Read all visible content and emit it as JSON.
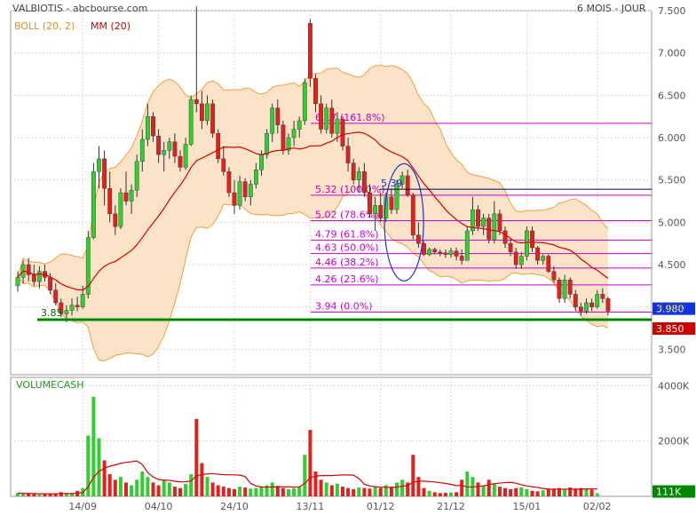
{
  "chart_data": {
    "type": "candlestick",
    "title": "VALBIOTIS - abcbourse.com",
    "period_label": "6 MOIS - JOUR",
    "indicators": {
      "boll_label": "BOLL (20, 2)",
      "ma_label": "MM (20)"
    },
    "x_labels": [
      "14/09",
      "04/10",
      "24/10",
      "13/11",
      "01/12",
      "21/12",
      "15/01",
      "02/02"
    ],
    "x_label_index": [
      12,
      26,
      40,
      54,
      67,
      80,
      94,
      107
    ],
    "price_axis": {
      "ylim": [
        3.2,
        7.5
      ],
      "ticks": [
        "3.500",
        "4.000",
        "4.500",
        "5.000",
        "5.500",
        "6.000",
        "6.500",
        "7.000",
        "7.500"
      ]
    },
    "last_price": "3.980",
    "support": {
      "value": 3.85,
      "left_label": "3.85",
      "right_label": "3.850"
    },
    "fibonacci": [
      {
        "value": 6.17,
        "label": "6.17  (161.8%)"
      },
      {
        "value": 5.32,
        "label": "5.32  (100.0%)"
      },
      {
        "value": 5.02,
        "label": "5.02  (78.6%)"
      },
      {
        "value": 4.79,
        "label": "4.79  (61.8%)"
      },
      {
        "value": 4.63,
        "label": "4.63  (50.0%)"
      },
      {
        "value": 4.46,
        "label": "4.46  (38.2%)"
      },
      {
        "value": 4.26,
        "label": "4.26  (23.6%)"
      },
      {
        "value": 3.94,
        "label": "3.94  (0.0%)"
      }
    ],
    "annotation": {
      "label": "5.39",
      "value": 5.39
    },
    "ohlc": [
      {
        "o": 4.25,
        "h": 4.42,
        "l": 4.18,
        "c": 4.35
      },
      {
        "o": 4.35,
        "h": 4.55,
        "l": 4.28,
        "c": 4.5
      },
      {
        "o": 4.5,
        "h": 4.58,
        "l": 4.3,
        "c": 4.38
      },
      {
        "o": 4.38,
        "h": 4.5,
        "l": 4.25,
        "c": 4.3
      },
      {
        "o": 4.3,
        "h": 4.48,
        "l": 4.22,
        "c": 4.42
      },
      {
        "o": 4.42,
        "h": 4.5,
        "l": 4.3,
        "c": 4.35
      },
      {
        "o": 4.35,
        "h": 4.4,
        "l": 4.15,
        "c": 4.2
      },
      {
        "o": 4.2,
        "h": 4.28,
        "l": 4.02,
        "c": 4.05
      },
      {
        "o": 4.05,
        "h": 4.1,
        "l": 3.88,
        "c": 3.92
      },
      {
        "o": 3.92,
        "h": 4.02,
        "l": 3.82,
        "c": 3.96
      },
      {
        "o": 3.96,
        "h": 4.1,
        "l": 3.9,
        "c": 4.02
      },
      {
        "o": 4.02,
        "h": 4.12,
        "l": 3.95,
        "c": 4.0
      },
      {
        "o": 4.0,
        "h": 4.25,
        "l": 3.98,
        "c": 4.15
      },
      {
        "o": 4.15,
        "h": 4.9,
        "l": 4.1,
        "c": 4.82
      },
      {
        "o": 4.82,
        "h": 5.7,
        "l": 4.8,
        "c": 5.6
      },
      {
        "o": 5.6,
        "h": 5.9,
        "l": 5.4,
        "c": 5.75
      },
      {
        "o": 5.75,
        "h": 5.85,
        "l": 5.2,
        "c": 5.4
      },
      {
        "o": 5.4,
        "h": 5.6,
        "l": 5.0,
        "c": 5.1
      },
      {
        "o": 5.1,
        "h": 5.2,
        "l": 4.85,
        "c": 4.95
      },
      {
        "o": 4.95,
        "h": 5.4,
        "l": 4.92,
        "c": 5.35
      },
      {
        "o": 5.35,
        "h": 5.6,
        "l": 5.2,
        "c": 5.25
      },
      {
        "o": 5.25,
        "h": 5.45,
        "l": 5.1,
        "c": 5.38
      },
      {
        "o": 5.38,
        "h": 5.8,
        "l": 5.3,
        "c": 5.72
      },
      {
        "o": 5.72,
        "h": 6.1,
        "l": 5.6,
        "c": 5.98
      },
      {
        "o": 5.98,
        "h": 6.4,
        "l": 5.9,
        "c": 6.25
      },
      {
        "o": 6.25,
        "h": 6.3,
        "l": 5.95,
        "c": 6.02
      },
      {
        "o": 6.02,
        "h": 6.1,
        "l": 5.7,
        "c": 5.8
      },
      {
        "o": 5.8,
        "h": 5.95,
        "l": 5.6,
        "c": 5.85
      },
      {
        "o": 5.85,
        "h": 6.0,
        "l": 5.75,
        "c": 5.95
      },
      {
        "o": 5.95,
        "h": 6.05,
        "l": 5.7,
        "c": 5.78
      },
      {
        "o": 5.78,
        "h": 5.85,
        "l": 5.6,
        "c": 5.65
      },
      {
        "o": 5.65,
        "h": 6.0,
        "l": 5.62,
        "c": 5.92
      },
      {
        "o": 5.92,
        "h": 6.5,
        "l": 5.9,
        "c": 6.45
      },
      {
        "o": 6.45,
        "h": 7.55,
        "l": 6.3,
        "c": 6.4
      },
      {
        "o": 6.4,
        "h": 6.55,
        "l": 6.1,
        "c": 6.2
      },
      {
        "o": 6.2,
        "h": 6.5,
        "l": 6.15,
        "c": 6.4
      },
      {
        "o": 6.4,
        "h": 6.45,
        "l": 6.0,
        "c": 6.05
      },
      {
        "o": 6.05,
        "h": 6.1,
        "l": 5.7,
        "c": 5.75
      },
      {
        "o": 5.75,
        "h": 5.9,
        "l": 5.55,
        "c": 5.6
      },
      {
        "o": 5.6,
        "h": 5.65,
        "l": 5.3,
        "c": 5.35
      },
      {
        "o": 5.35,
        "h": 5.5,
        "l": 5.1,
        "c": 5.2
      },
      {
        "o": 5.2,
        "h": 5.55,
        "l": 5.15,
        "c": 5.48
      },
      {
        "o": 5.48,
        "h": 5.52,
        "l": 5.25,
        "c": 5.3
      },
      {
        "o": 5.3,
        "h": 5.5,
        "l": 5.2,
        "c": 5.45
      },
      {
        "o": 5.45,
        "h": 5.7,
        "l": 5.4,
        "c": 5.62
      },
      {
        "o": 5.62,
        "h": 5.85,
        "l": 5.55,
        "c": 5.8
      },
      {
        "o": 5.8,
        "h": 6.1,
        "l": 5.75,
        "c": 6.05
      },
      {
        "o": 6.05,
        "h": 6.4,
        "l": 5.95,
        "c": 6.35
      },
      {
        "o": 6.35,
        "h": 6.45,
        "l": 6.05,
        "c": 6.15
      },
      {
        "o": 6.15,
        "h": 6.2,
        "l": 5.8,
        "c": 5.85
      },
      {
        "o": 5.85,
        "h": 6.05,
        "l": 5.8,
        "c": 6.0
      },
      {
        "o": 6.0,
        "h": 6.2,
        "l": 5.9,
        "c": 6.1
      },
      {
        "o": 6.1,
        "h": 6.25,
        "l": 6.0,
        "c": 6.2
      },
      {
        "o": 6.2,
        "h": 6.7,
        "l": 6.15,
        "c": 6.65
      },
      {
        "o": 7.35,
        "h": 7.4,
        "l": 6.6,
        "c": 6.7
      },
      {
        "o": 6.7,
        "h": 6.75,
        "l": 6.3,
        "c": 6.4
      },
      {
        "o": 6.4,
        "h": 6.5,
        "l": 6.05,
        "c": 6.1
      },
      {
        "o": 6.1,
        "h": 6.4,
        "l": 6.05,
        "c": 6.35
      },
      {
        "o": 6.35,
        "h": 6.45,
        "l": 6.0,
        "c": 6.05
      },
      {
        "o": 6.05,
        "h": 6.3,
        "l": 5.95,
        "c": 6.22
      },
      {
        "o": 6.22,
        "h": 6.25,
        "l": 5.85,
        "c": 5.9
      },
      {
        "o": 5.9,
        "h": 6.0,
        "l": 5.6,
        "c": 5.7
      },
      {
        "o": 5.7,
        "h": 5.75,
        "l": 5.45,
        "c": 5.5
      },
      {
        "o": 5.5,
        "h": 5.65,
        "l": 5.35,
        "c": 5.6
      },
      {
        "o": 5.6,
        "h": 5.7,
        "l": 5.3,
        "c": 5.35
      },
      {
        "o": 5.35,
        "h": 5.45,
        "l": 5.05,
        "c": 5.1
      },
      {
        "o": 5.1,
        "h": 5.3,
        "l": 4.9,
        "c": 5.2
      },
      {
        "o": 5.2,
        "h": 5.35,
        "l": 5.0,
        "c": 5.05
      },
      {
        "o": 5.05,
        "h": 5.35,
        "l": 5.0,
        "c": 5.3
      },
      {
        "o": 5.3,
        "h": 5.4,
        "l": 5.1,
        "c": 5.15
      },
      {
        "o": 5.15,
        "h": 5.5,
        "l": 5.1,
        "c": 5.45
      },
      {
        "o": 5.45,
        "h": 5.6,
        "l": 5.4,
        "c": 5.55
      },
      {
        "o": 5.55,
        "h": 5.62,
        "l": 5.3,
        "c": 5.32
      },
      {
        "o": 5.32,
        "h": 5.35,
        "l": 4.8,
        "c": 4.85
      },
      {
        "o": 4.85,
        "h": 5.0,
        "l": 4.7,
        "c": 4.75
      },
      {
        "o": 4.75,
        "h": 4.78,
        "l": 4.6,
        "c": 4.62
      },
      {
        "o": 4.62,
        "h": 4.7,
        "l": 4.6,
        "c": 4.68
      },
      {
        "o": 4.68,
        "h": 4.7,
        "l": 4.62,
        "c": 4.65
      },
      {
        "o": 4.65,
        "h": 4.68,
        "l": 4.6,
        "c": 4.64
      },
      {
        "o": 4.64,
        "h": 4.68,
        "l": 4.58,
        "c": 4.62
      },
      {
        "o": 4.62,
        "h": 4.7,
        "l": 4.58,
        "c": 4.66
      },
      {
        "o": 4.66,
        "h": 4.7,
        "l": 4.55,
        "c": 4.6
      },
      {
        "o": 4.6,
        "h": 4.68,
        "l": 4.5,
        "c": 4.55
      },
      {
        "o": 4.55,
        "h": 4.95,
        "l": 4.55,
        "c": 4.9
      },
      {
        "o": 4.9,
        "h": 5.3,
        "l": 4.85,
        "c": 5.15
      },
      {
        "o": 5.15,
        "h": 5.2,
        "l": 4.9,
        "c": 4.95
      },
      {
        "o": 4.95,
        "h": 5.1,
        "l": 4.85,
        "c": 5.05
      },
      {
        "o": 5.05,
        "h": 5.1,
        "l": 4.75,
        "c": 4.8
      },
      {
        "o": 4.8,
        "h": 5.25,
        "l": 4.75,
        "c": 5.1
      },
      {
        "o": 5.1,
        "h": 5.15,
        "l": 4.85,
        "c": 4.9
      },
      {
        "o": 4.9,
        "h": 4.95,
        "l": 4.7,
        "c": 4.75
      },
      {
        "o": 4.75,
        "h": 4.8,
        "l": 4.6,
        "c": 4.65
      },
      {
        "o": 4.65,
        "h": 4.7,
        "l": 4.45,
        "c": 4.5
      },
      {
        "o": 4.5,
        "h": 4.65,
        "l": 4.45,
        "c": 4.6
      },
      {
        "o": 4.6,
        "h": 4.95,
        "l": 4.55,
        "c": 4.9
      },
      {
        "o": 4.9,
        "h": 4.95,
        "l": 4.65,
        "c": 4.7
      },
      {
        "o": 4.7,
        "h": 4.72,
        "l": 4.5,
        "c": 4.55
      },
      {
        "o": 4.55,
        "h": 4.62,
        "l": 4.5,
        "c": 4.6
      },
      {
        "o": 4.6,
        "h": 4.62,
        "l": 4.4,
        "c": 4.42
      },
      {
        "o": 4.42,
        "h": 4.48,
        "l": 4.28,
        "c": 4.32
      },
      {
        "o": 4.32,
        "h": 4.35,
        "l": 4.05,
        "c": 4.1
      },
      {
        "o": 4.1,
        "h": 4.38,
        "l": 4.05,
        "c": 4.32
      },
      {
        "o": 4.32,
        "h": 4.35,
        "l": 4.1,
        "c": 4.15
      },
      {
        "o": 4.15,
        "h": 4.2,
        "l": 3.95,
        "c": 4.0
      },
      {
        "o": 4.0,
        "h": 4.05,
        "l": 3.9,
        "c": 3.95
      },
      {
        "o": 3.95,
        "h": 4.1,
        "l": 3.92,
        "c": 4.05
      },
      {
        "o": 4.05,
        "h": 4.1,
        "l": 3.95,
        "c": 4.0
      },
      {
        "o": 4.0,
        "h": 4.2,
        "l": 3.98,
        "c": 4.15
      },
      {
        "o": 4.15,
        "h": 4.22,
        "l": 4.05,
        "c": 4.1
      },
      {
        "o": 4.1,
        "h": 4.12,
        "l": 3.9,
        "c": 3.95
      }
    ],
    "volume": {
      "label": "VOLUMECASH",
      "ylim": [
        0,
        4300
      ],
      "ticks": [
        "2000K",
        "4000K"
      ],
      "last_label": "111K",
      "values": [
        120,
        90,
        110,
        80,
        70,
        90,
        100,
        80,
        150,
        120,
        130,
        200,
        300,
        2200,
        3600,
        2100,
        1300,
        800,
        600,
        700,
        500,
        400,
        600,
        900,
        700,
        500,
        400,
        600,
        500,
        350,
        300,
        450,
        800,
        2800,
        1200,
        700,
        500,
        400,
        350,
        300,
        260,
        350,
        320,
        280,
        300,
        350,
        400,
        500,
        380,
        300,
        260,
        300,
        350,
        1500,
        2400,
        900,
        600,
        500,
        400,
        450,
        350,
        300,
        260,
        320,
        300,
        280,
        350,
        300,
        400,
        350,
        500,
        600,
        500,
        1500,
        700,
        300,
        200,
        150,
        120,
        130,
        140,
        150,
        600,
        900,
        700,
        500,
        400,
        600,
        450,
        350,
        300,
        260,
        300,
        320,
        260,
        200,
        180,
        220,
        260,
        280,
        300,
        260,
        320,
        280,
        300,
        280,
        250,
        111
      ]
    },
    "colors": {
      "up": "#33cc33",
      "down": "#dd2222",
      "ma": "#dd0000",
      "boll_fill": "#fbe3c7",
      "boll_line": "#f0a040",
      "fib": "#cc00cc",
      "support": "#008800",
      "ellipse": "#2233cc",
      "last_box": "#1133dd",
      "support_box": "#cc0000"
    }
  }
}
